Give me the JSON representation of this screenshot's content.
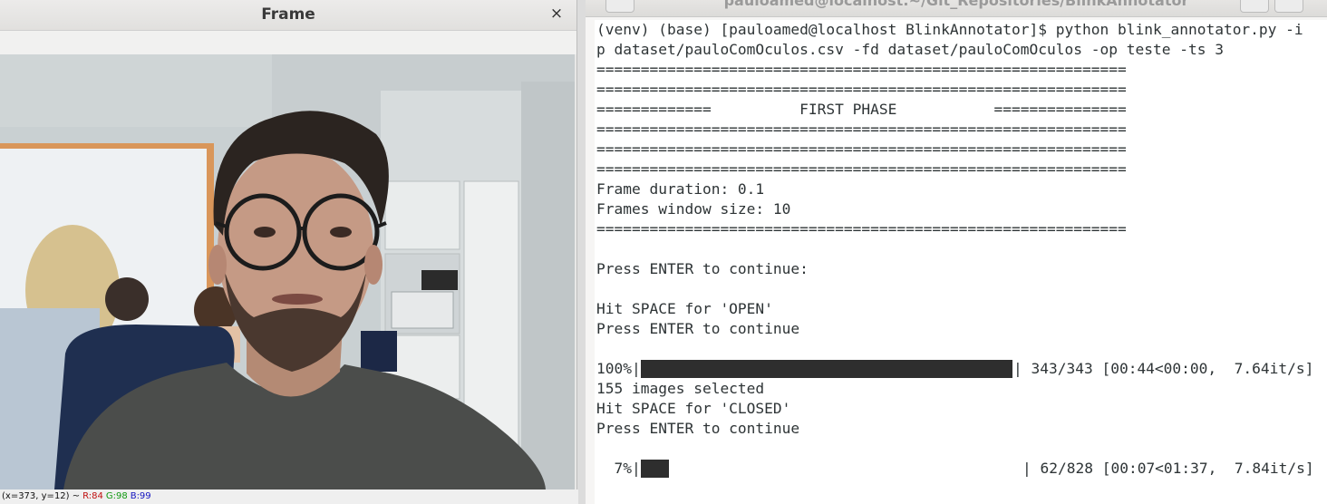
{
  "frame_window": {
    "title": "Frame",
    "close_glyph": "×",
    "statusbar": {
      "coords": "(x=373, y=12) ~",
      "r": "R:84",
      "g": "G:98",
      "b": "B:99"
    }
  },
  "terminal": {
    "title": "pauloamed@localhost:~/Git_Repositories/BlinkAnnotator",
    "lines": [
      "(venv) (base) [pauloamed@localhost BlinkAnnotator]$ python blink_annotator.py -i",
      "p dataset/pauloComOculos.csv -fd dataset/pauloComOculos -op teste -ts 3",
      "============================================================",
      "============================================================",
      "=============          FIRST PHASE           ===============",
      "============================================================",
      "============================================================",
      "============================================================",
      "Frame duration: 0.1",
      "Frames window size: 10",
      "============================================================",
      "",
      "Press ENTER to continue:",
      "",
      "Hit SPACE for 'OPEN'",
      "Press ENTER to continue",
      "",
      "",
      "155 images selected",
      "Hit SPACE for 'CLOSED'",
      "Press ENTER to continue",
      "",
      ""
    ],
    "progress1": {
      "percent_label": "100%|",
      "fraction": 1.0,
      "stats": "| 343/343 [00:44<00:00,  7.64it/s]"
    },
    "progress2": {
      "percent_label": "  7%|",
      "fraction": 0.075,
      "stats": "| 62/828 [00:07<01:37,  7.84it/s]"
    }
  },
  "colors": {
    "terminal_text": "#2e3436",
    "progress_fill": "#2e2e2e"
  }
}
